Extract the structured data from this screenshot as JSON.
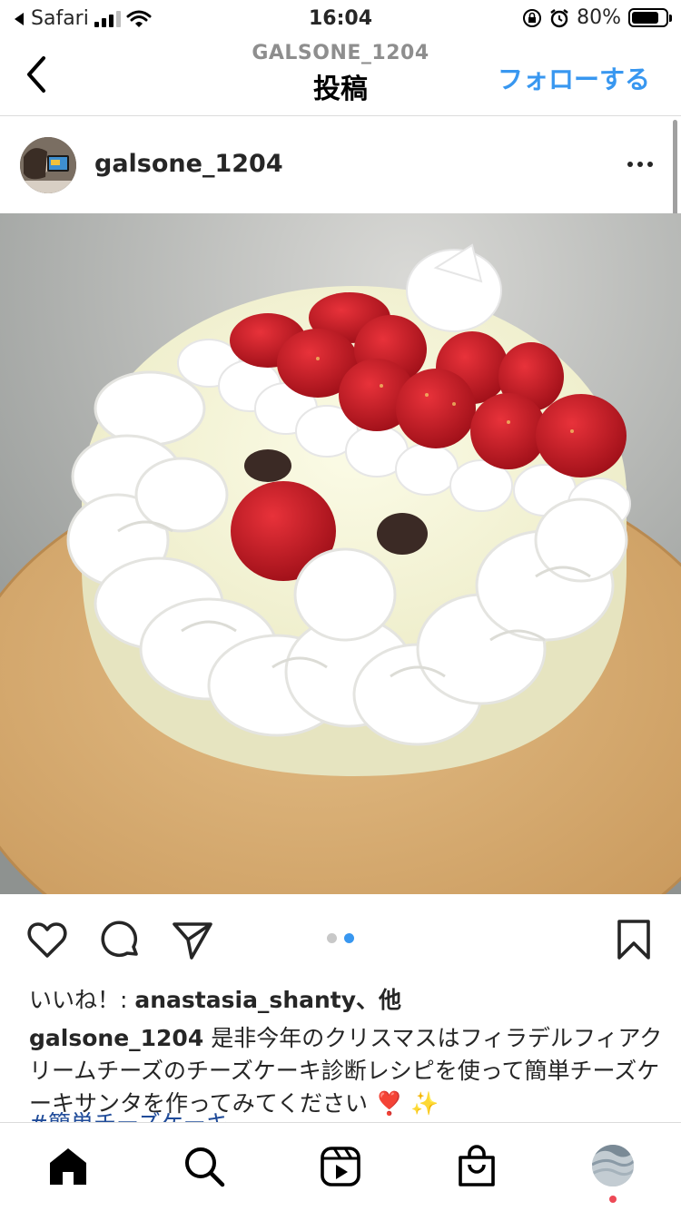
{
  "status_bar": {
    "back_app": "Safari",
    "time": "16:04",
    "battery": "80%",
    "battery_level": 0.8
  },
  "header": {
    "subtitle": "GALSONE_1204",
    "title": "投稿",
    "follow_label": "フォローする",
    "accent_color": "#3897f0"
  },
  "post": {
    "username": "galsone_1204",
    "image_description_icon": "cake-photo",
    "carousel": {
      "total": 2,
      "active": 2
    },
    "likes_prefix": "いいね！: ",
    "likes_user": "anastasia_shanty",
    "likes_suffix": "、他",
    "caption_user": "galsone_1204",
    "caption_text": "是非今年のクリスマスはフィラデルフィアクリームチーズのチーズケーキ診断レシピを使って簡単チーズケーキサンタを作ってみてください ❣️ ✨",
    "caption_cut": "#簡単チーズケーキ"
  },
  "tabs": [
    {
      "name": "home-icon"
    },
    {
      "name": "search-icon"
    },
    {
      "name": "reels-icon"
    },
    {
      "name": "shop-icon"
    },
    {
      "name": "profile-icon"
    }
  ]
}
